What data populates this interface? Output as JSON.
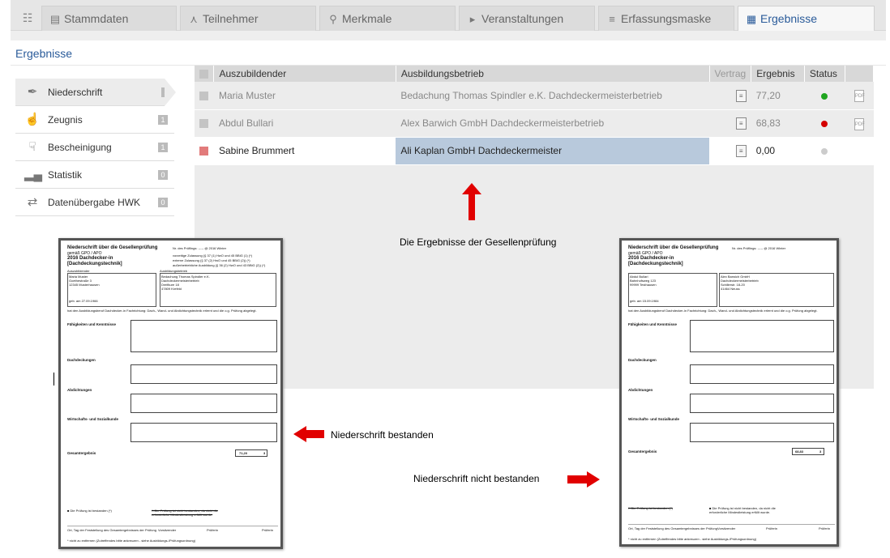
{
  "tabs": [
    {
      "label": "Stammdaten",
      "icon": "database-icon"
    },
    {
      "label": "Teilnehmer",
      "icon": "network-icon"
    },
    {
      "label": "Merkmale",
      "icon": "pin-icon"
    },
    {
      "label": "Veranstaltungen",
      "icon": "megaphone-icon"
    },
    {
      "label": "Erfassungsmaske",
      "icon": "list-icon"
    },
    {
      "label": "Ergebnisse",
      "icon": "table-icon"
    }
  ],
  "page_title": "Ergebnisse",
  "sidebar": {
    "items": [
      {
        "label": "Niederschrift",
        "count": "3",
        "icon": "pen-icon"
      },
      {
        "label": "Zeugnis",
        "count": "1",
        "icon": "thumbs-up-icon"
      },
      {
        "label": "Bescheinigung",
        "count": "1",
        "icon": "thumbs-down-icon"
      },
      {
        "label": "Statistik",
        "count": "0",
        "icon": "bar-chart-icon"
      },
      {
        "label": "Datenübergabe HWK",
        "count": "0",
        "icon": "transfer-icon"
      }
    ]
  },
  "table": {
    "headers": {
      "auszubildender": "Auszubildender",
      "betrieb": "Ausbildungsbetrieb",
      "vertrag": "Vertrag",
      "ergebnis": "Ergebnis",
      "status": "Status"
    },
    "rows": [
      {
        "name": "Maria Muster",
        "betrieb": "Bedachung Thomas Spindler e.K. Dachdeckermeisterbetrieb",
        "ergebnis": "77,20",
        "status_color": "#1fa51f",
        "pdf": true
      },
      {
        "name": "Abdul Bullari",
        "betrieb": "Alex Barwich GmbH Dachdeckermeisterbetrieb",
        "ergebnis": "68,83",
        "status_color": "#d40000",
        "pdf": true
      },
      {
        "name": "Sabine Brummert",
        "betrieb": "Ali Kaplan GmbH Dachdeckermeister",
        "ergebnis": "0,00",
        "status_color": "#cccccc",
        "pdf": false
      }
    ]
  },
  "annotations": {
    "results": "Die Ergebnisse der Gesellenprüfung",
    "passed": "Niederschrift bestanden",
    "failed": "Niederschrift nicht bestanden"
  },
  "doc_left": {
    "title": "Niederschrift über die Gesellenprüfung",
    "subtitle": "gemäß GPO / APO",
    "trade": "2016 Dachdecker-in",
    "trade2": "[Dachdeckungstechnik]",
    "nr": "Nr. des Prüflings: ----- @ 2016 Winter",
    "opt1": "vorzeitige Zulassung (§ 37 (1) HwO und 45 BBiG (1) (*)",
    "opt2": "externe Zulassung (§ 37 (2) HwO und 45 BBiG (2)) (*)",
    "opt3": "außerbetriebliche Ausbildung (§ 36 (2) HwO und 43 BBiG (2)) (*)",
    "azubi_label": "Auszubildender",
    "betrieb_label": "Ausbildungsbetrieb",
    "person": "Maria Muster",
    "street": "Goethestraße 3",
    "city": "12345 Musterhausen",
    "firm": "Bedachung Thomas Spindler e.K.",
    "firm2": "Dachdeckermeisterbetrieb",
    "firm3": "Dreifkure 18",
    "firm4": "47809 Krefeld",
    "born": "geb. am 27.09.1966",
    "statement": "hat den Ausbildungsberuf Dachdecker-in Fachrichtung: Dach-, Wand- und Abdichtungstechnik erlernt und die o.g. Prüfung abgelegt.",
    "sec1": "Fähigkeiten und Kenntnisse",
    "sec2": "Dachdeckungen",
    "sec3": "Abdichtungen",
    "sec4": "Wirtschafts- und Sozialkunde",
    "gesamt": "Gesamtergebnis",
    "gesamt_value": "71,20",
    "gesamt_note": "3",
    "pass": "Die Prüfung ist bestanden (*)",
    "fail": "Die Prüfung ist nicht bestanden, da nicht die erforderliche Mindestleistung erfüllt wurde.",
    "sig1": "Ort, Tag der Feststellung des Gesamtergebnisses der Prüfung",
    "sig2": "Vorsitzender",
    "sig3": "Prüferin",
    "sig4": "Prüferin",
    "foot": "* nicht zu entfernen (Zutreffendes bitte ankreuzen - siehe Ausbildungs-/Prüfungsordnung)"
  },
  "doc_right": {
    "title": "Niederschrift über die Gesellenprüfung",
    "subtitle": "gemäß GPO / APO",
    "trade": "2016 Dachdecker-in",
    "trade2": "[Dachdeckungstechnik]",
    "nr": "Nr. des Prüflings: ----- @ 2016 Winter",
    "person": "Abdul Bullari",
    "street": "Bahnhofsweg 123",
    "city": "99999 Testhausen",
    "firm": "Alex Barwich GmbH",
    "firm2": "Dachdeckermeisterbetrieb",
    "firm3": "Schillerstr. 18-20",
    "firm4": "41464 Neuss",
    "born": "geb. am 15.09.1984",
    "statement": "hat den Ausbildungsberuf Dachdecker-in Fachrichtung: Dach-, Wand- und Abdichtungstechnik erlernt und die o.g. Prüfung abgelegt.",
    "sec1": "Fähigkeiten und Kenntnisse",
    "sec2": "Dachdeckungen",
    "sec3": "Abdichtungen",
    "sec4": "Wirtschafts- und Sozialkunde",
    "gesamt": "Gesamtergebnis",
    "gesamt_value": "68,83",
    "gesamt_note": "3",
    "pass": "Die Prüfung ist bestanden (*)",
    "fail": "Die Prüfung ist nicht bestanden, da nicht die erforderliche Mindestleistung erfüllt wurde.",
    "sig1": "Ort, Tag der Feststellung des Gesamtergebnisses der Prüfung",
    "sig2": "Vorsitzender",
    "sig3": "Prüferin",
    "sig4": "Prüferin",
    "foot": "* nicht zu entfernen (Zutreffendes bitte ankreuzen - siehe Ausbildungs-/Prüfungsordnung)"
  }
}
